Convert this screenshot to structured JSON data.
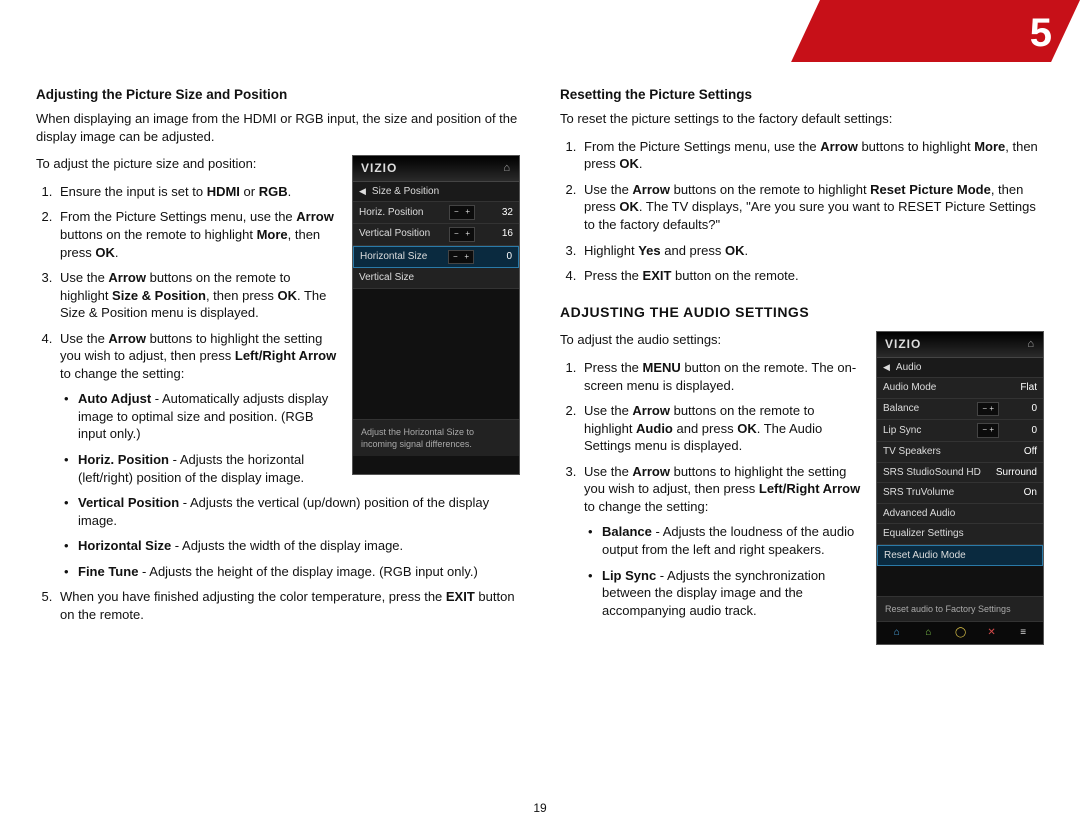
{
  "chapter_number": "5",
  "page_number": "19",
  "left": {
    "h1": "Adjusting the Picture Size and Position",
    "intro": "When displaying an image from the HDMI or RGB input, the size and position of the display image can be adjusted.",
    "lead": "To adjust the picture size and position:",
    "s1a": "Ensure the input is set to ",
    "s1b": "HDMI",
    "s1c": " or ",
    "s1d": "RGB",
    "s1e": ".",
    "s2a": "From the Picture Settings menu, use the ",
    "s2b": "Arrow",
    "s2c": " buttons on the remote to highlight ",
    "s2d": "More",
    "s2e": ", then press ",
    "s2f": "OK",
    "s2g": ".",
    "s3a": "Use the ",
    "s3b": "Arrow",
    "s3c": " buttons on the remote to highlight ",
    "s3d": "Size & Position",
    "s3e": ", then press ",
    "s3f": "OK",
    "s3g": ". The Size & Position menu is displayed.",
    "s4a": "Use the ",
    "s4b": "Arrow",
    "s4c": " buttons to highlight the setting you wish to adjust, then press ",
    "s4d": "Left/Right Arrow",
    "s4e": " to change the setting:",
    "b1a": "Auto Adjust",
    "b1b": " - Automatically adjusts display image to optimal size and position. (RGB input only.)",
    "b2a": "Horiz. Position",
    "b2b": " - Adjusts the horizontal (left/right) position of the display image.",
    "b3a": "Vertical Position",
    "b3b": " - Adjusts the vertical (up/down) position of the display image.",
    "b4a": "Horizontal Size",
    "b4b": " - Adjusts the width of the display image.",
    "b5a": "Fine Tune",
    "b5b": " - Adjusts the height of the display image. (RGB input only.)",
    "s5a": "When you have finished adjusting the color temperature, press the ",
    "s5b": "EXIT",
    "s5c": " button on the remote.",
    "shot": {
      "brand": "VIZIO",
      "crumb": "Size & Position",
      "rows": [
        {
          "label": "Horiz. Position",
          "value": "32"
        },
        {
          "label": "Vertical Position",
          "value": "16"
        },
        {
          "label": "Horizontal Size",
          "value": "0"
        },
        {
          "label": "Vertical Size",
          "value": ""
        }
      ],
      "hint": "Adjust the Horizontal Size to incoming signal differences."
    }
  },
  "right": {
    "h1": "Resetting the Picture Settings",
    "intro": "To reset the picture settings to the factory default settings:",
    "r1a": "From the Picture Settings menu, use the ",
    "r1b": "Arrow",
    "r1c": " buttons to highlight ",
    "r1d": "More",
    "r1e": ", then press ",
    "r1f": "OK",
    "r1g": ".",
    "r2a": "Use the ",
    "r2b": "Arrow",
    "r2c": " buttons on the remote to highlight ",
    "r2d": "Reset Picture Mode",
    "r2e": ", then press ",
    "r2f": "OK",
    "r2g": ". The TV displays, \"Are you sure you want to RESET Picture Settings to the factory defaults?\"",
    "r3a": "Highlight ",
    "r3b": "Yes",
    "r3c": " and press ",
    "r3d": "OK",
    "r3e": ".",
    "r4a": "Press the ",
    "r4b": "EXIT",
    "r4c": " button on the remote.",
    "h2": "Adjusting the Audio Settings",
    "alead": "To adjust the audio settings:",
    "a1a": "Press the ",
    "a1b": "MENU",
    "a1c": " button on the remote. The on-screen menu is displayed.",
    "a2a": "Use the ",
    "a2b": "Arrow",
    "a2c": " buttons on the remote to highlight ",
    "a2d": "Audio",
    "a2e": " and press ",
    "a2f": "OK",
    "a2g": ". The Audio Settings menu is displayed.",
    "a3a": "Use the ",
    "a3b": "Arrow",
    "a3c": " buttons to highlight the setting you wish to adjust, then press ",
    "a3d": "Left/Right Arrow",
    "a3e": " to change the setting:",
    "ab1a": "Balance",
    "ab1b": " - Adjusts the loudness of the audio output from the left and right speakers.",
    "ab2a": "Lip Sync",
    "ab2b": " - Adjusts the synchronization between the display image and the accompanying audio track.",
    "shot": {
      "brand": "VIZIO",
      "crumb": "Audio",
      "rows": [
        {
          "label": "Audio Mode",
          "value": "Flat"
        },
        {
          "label": "Balance",
          "value": "0"
        },
        {
          "label": "Lip Sync",
          "value": "0"
        },
        {
          "label": "TV Speakers",
          "value": "Off"
        },
        {
          "label": "SRS StudioSound HD",
          "value": "Surround"
        },
        {
          "label": "SRS TruVolume",
          "value": "On"
        },
        {
          "label": "Advanced Audio",
          "value": ""
        },
        {
          "label": "Equalizer Settings",
          "value": ""
        },
        {
          "label": "Reset Audio Mode",
          "value": ""
        }
      ],
      "hint": "Reset audio to Factory Settings",
      "foot": [
        "⌂",
        "⌂",
        "◯",
        "✕",
        "≡"
      ],
      "foot_colors": [
        "#4aa3df",
        "#7cc24a",
        "#e2c84a",
        "#d54a4a",
        "#dddddd"
      ]
    }
  }
}
